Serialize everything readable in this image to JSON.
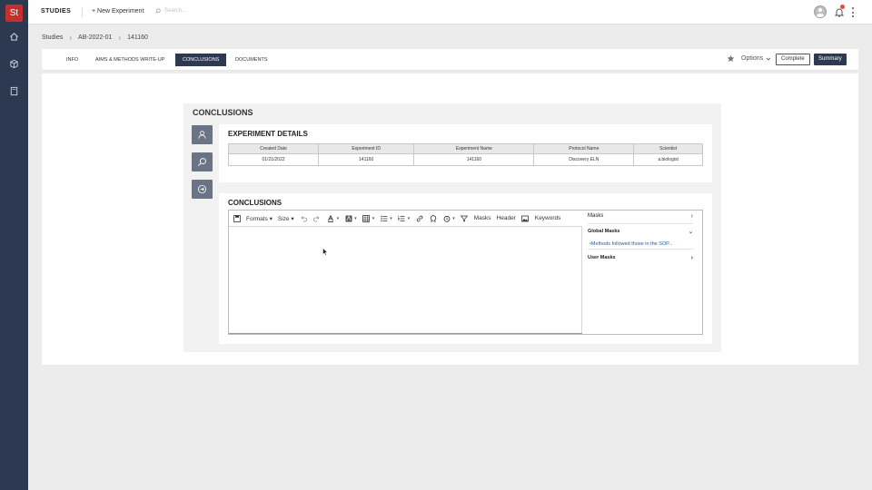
{
  "app": {
    "logo_text": "St",
    "title": "STUDIES",
    "new_experiment": "+ New Experiment",
    "search_placeholder": "Search..."
  },
  "rail": {
    "icons": [
      "home-icon",
      "cube-icon",
      "notebook-icon"
    ]
  },
  "breadcrumb": [
    "Studies",
    "AB-2022-01",
    "141160"
  ],
  "tabs": [
    {
      "label": "INFO",
      "active": false
    },
    {
      "label": "AIMS & METHODS WRITE-UP",
      "active": false
    },
    {
      "label": "CONCLUSIONS",
      "active": true
    },
    {
      "label": "DOCUMENTS",
      "active": false
    }
  ],
  "actions": {
    "options_label": "Options",
    "complete_label": "Complete",
    "summary_label": "Summary"
  },
  "panel": {
    "title": "CONCLUSIONS",
    "side_icons": [
      "user-icon",
      "search-icon",
      "arrow-right-circle-icon"
    ]
  },
  "details": {
    "title": "EXPERIMENT DETAILS",
    "columns": [
      "Created Date",
      "Experiment ID",
      "Experiment Name",
      "Protocol Name",
      "Scientist"
    ],
    "row": [
      "01/21/2022",
      "141160",
      "141160",
      "Discovery ELN",
      "a.biologist"
    ]
  },
  "conclusions": {
    "title": "CONCLUSIONS",
    "toolbar": {
      "formats": "Formats",
      "size": "Size",
      "masks": "Masks",
      "header": "Header",
      "keywords": "Keywords"
    },
    "masks_panel": {
      "title": "Masks",
      "global_label": "Global Masks",
      "global_item": "•Methods followed those in the SOP...",
      "user_label": "User Masks"
    }
  },
  "colors": {
    "nav_dark": "#2c3950",
    "logo_red": "#c4302b",
    "side_button": "#6a7485",
    "link_blue": "#1e5faa"
  }
}
